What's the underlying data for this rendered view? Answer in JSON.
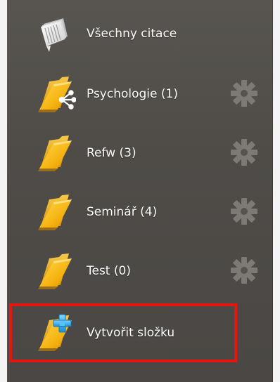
{
  "folders_panel": {
    "all_citations": {
      "label": "Všechny citace",
      "icon": "stacked-papers-icon"
    },
    "folders": [
      {
        "label": "Psychologie (1)",
        "icon": "shared-folder-icon",
        "has_settings": true
      },
      {
        "label": "Refw (3)",
        "icon": "folder-icon",
        "has_settings": true
      },
      {
        "label": "Seminář (4)",
        "icon": "folder-icon",
        "has_settings": true
      },
      {
        "label": "Test (0)",
        "icon": "folder-icon",
        "has_settings": true
      }
    ],
    "create_folder": {
      "label": "Vytvořit složku",
      "icon": "folder-add-icon"
    },
    "colors": {
      "panel_background": "#4f4c48",
      "folder_yellow": "#f5b80f",
      "plus_blue": "#2fa8e6",
      "highlight_border": "#e8150f",
      "gear_gray": "#7d7a76"
    }
  }
}
